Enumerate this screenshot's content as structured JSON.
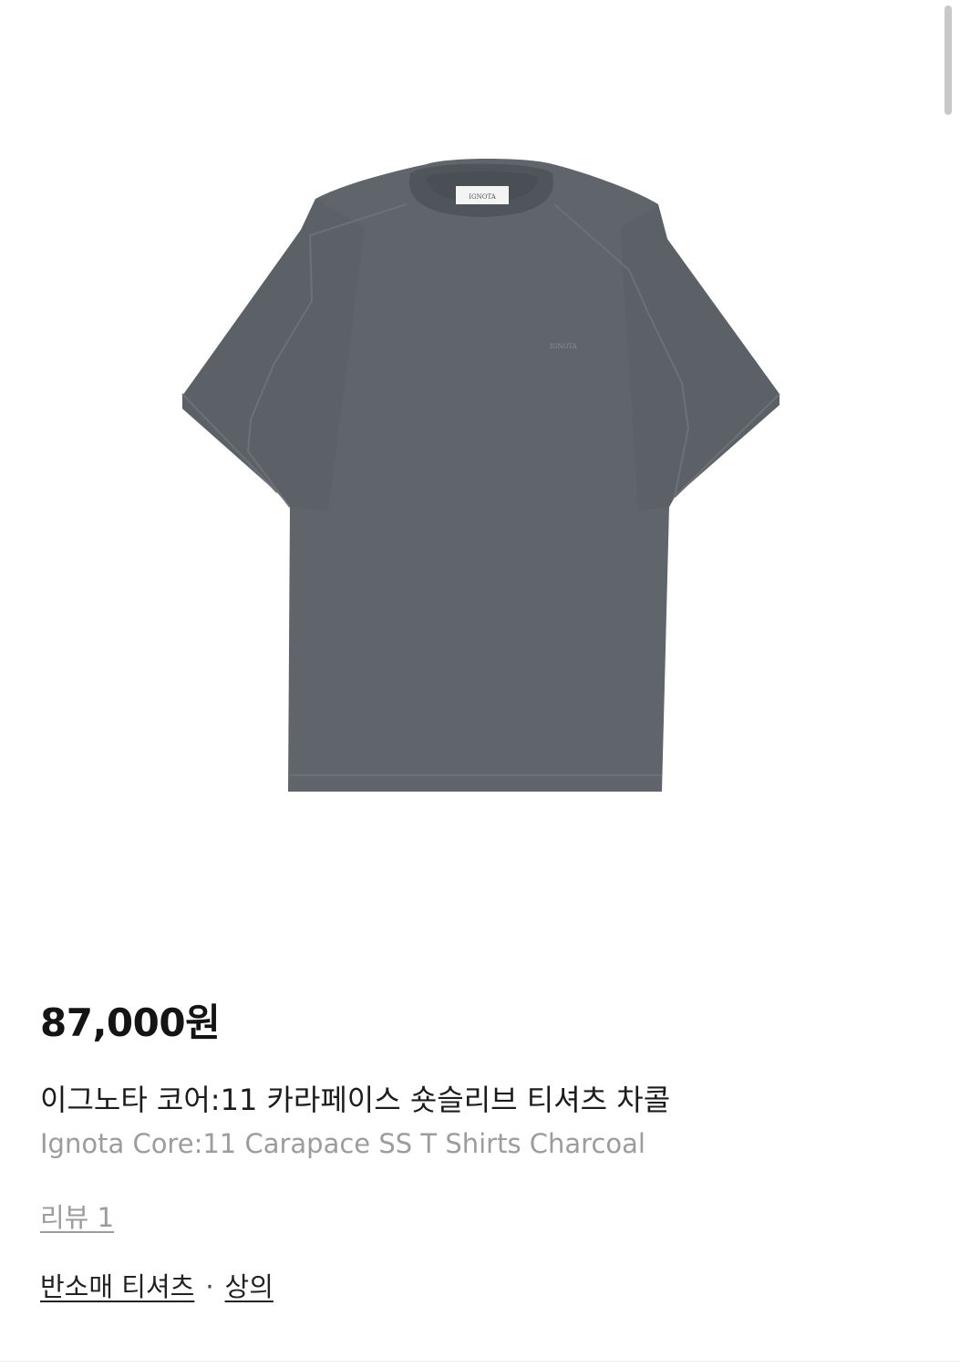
{
  "product": {
    "image_alt": "Charcoal short sleeve t-shirt",
    "shirt_color": "#60656b",
    "label_text": "IGNOTA",
    "price": "87,000원",
    "name_ko": "이그노타 코어:11 카라페이스 숏슬리브 티셔츠 차콜",
    "name_en": "Ignota Core:11 Carapace SS T Shirts Charcoal",
    "reviews_label": "리뷰 1"
  },
  "categories": {
    "primary": "반소매 티셔츠",
    "separator": "·",
    "secondary": "상의"
  }
}
